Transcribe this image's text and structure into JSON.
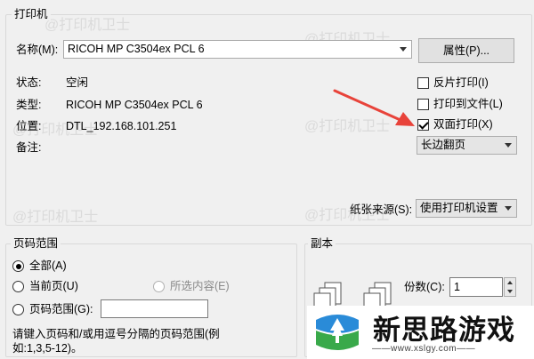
{
  "printer": {
    "group_title": "打印机",
    "name_label": "名称(M):",
    "name_value": "RICOH MP C3504ex PCL 6",
    "properties_button": "属性(P)...",
    "status_label": "状态:",
    "status_value": "空闲",
    "type_label": "类型:",
    "type_value": "RICOH MP C3504ex PCL 6",
    "location_label": "位置:",
    "location_value": "DTL_192.168.101.251",
    "comment_label": "备注:",
    "options": {
      "reverse_print": {
        "label": "反片打印(I)",
        "checked": false
      },
      "print_to_file": {
        "label": "打印到文件(L)",
        "checked": false
      },
      "duplex": {
        "label": "双面打印(X)",
        "checked": true
      }
    },
    "duplex_mode": "长边翻页",
    "paper_source_label": "纸张来源(S):",
    "paper_source_value": "使用打印机设置"
  },
  "page_range": {
    "group_title": "页码范围",
    "all": {
      "label": "全部(A)",
      "selected": true
    },
    "current_page": {
      "label": "当前页(U)",
      "selected": false
    },
    "selection": {
      "label": "所选内容(E)",
      "selected": false,
      "disabled": true
    },
    "pages": {
      "label": "页码范围(G):",
      "selected": false,
      "value": ""
    },
    "hint": "请键入页码和/或用逗号分隔的页码范围(例如:1,3,5-12)。"
  },
  "copies": {
    "group_title": "副本",
    "count_label": "份数(C):",
    "count_value": "1"
  },
  "watermark": {
    "text": "@打印机卫士"
  },
  "brand": {
    "name": "新思路游戏",
    "url": "——www.xslgy.com——"
  },
  "colors": {
    "arrow": "#e8433a",
    "accent": "#1e7fd6"
  }
}
